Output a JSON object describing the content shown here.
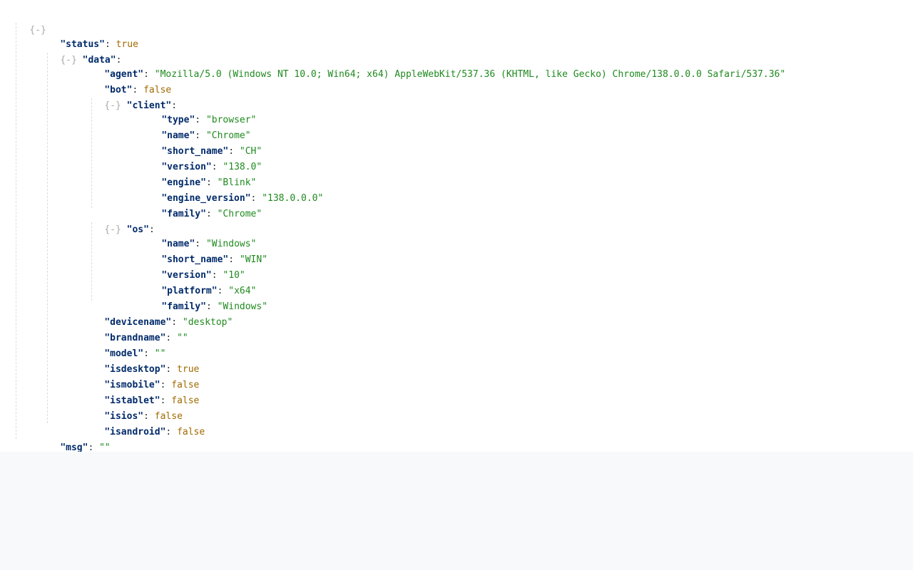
{
  "toggle_label": "{-}",
  "status": {
    "key": "\"status\"",
    "value": "true"
  },
  "data_key": "\"data\"",
  "agent": {
    "key": "\"agent\"",
    "value": "\"Mozilla/5.0 (Windows NT 10.0; Win64; x64) AppleWebKit/537.36 (KHTML, like Gecko) Chrome/138.0.0.0 Safari/537.36\""
  },
  "bot": {
    "key": "\"bot\"",
    "value": "false"
  },
  "client_key": "\"client\"",
  "client": {
    "type": {
      "key": "\"type\"",
      "value": "\"browser\""
    },
    "name": {
      "key": "\"name\"",
      "value": "\"Chrome\""
    },
    "short_name": {
      "key": "\"short_name\"",
      "value": "\"CH\""
    },
    "version": {
      "key": "\"version\"",
      "value": "\"138.0\""
    },
    "engine": {
      "key": "\"engine\"",
      "value": "\"Blink\""
    },
    "engine_version": {
      "key": "\"engine_version\"",
      "value": "\"138.0.0.0\""
    },
    "family": {
      "key": "\"family\"",
      "value": "\"Chrome\""
    }
  },
  "os_key": "\"os\"",
  "os": {
    "name": {
      "key": "\"name\"",
      "value": "\"Windows\""
    },
    "short_name": {
      "key": "\"short_name\"",
      "value": "\"WIN\""
    },
    "version": {
      "key": "\"version\"",
      "value": "\"10\""
    },
    "platform": {
      "key": "\"platform\"",
      "value": "\"x64\""
    },
    "family": {
      "key": "\"family\"",
      "value": "\"Windows\""
    }
  },
  "devicename": {
    "key": "\"devicename\"",
    "value": "\"desktop\""
  },
  "brandname": {
    "key": "\"brandname\"",
    "value": "\"\""
  },
  "model": {
    "key": "\"model\"",
    "value": "\"\""
  },
  "isdesktop": {
    "key": "\"isdesktop\"",
    "value": "true"
  },
  "ismobile": {
    "key": "\"ismobile\"",
    "value": "false"
  },
  "istablet": {
    "key": "\"istablet\"",
    "value": "false"
  },
  "isios": {
    "key": "\"isios\"",
    "value": "false"
  },
  "isandroid": {
    "key": "\"isandroid\"",
    "value": "false"
  },
  "msg": {
    "key": "\"msg\"",
    "value": "\"\""
  },
  "colors": {
    "key": "#002a6a",
    "string": "#1f8a1f",
    "boolean": "#a06a00",
    "toggle": "#aaaaaa"
  }
}
